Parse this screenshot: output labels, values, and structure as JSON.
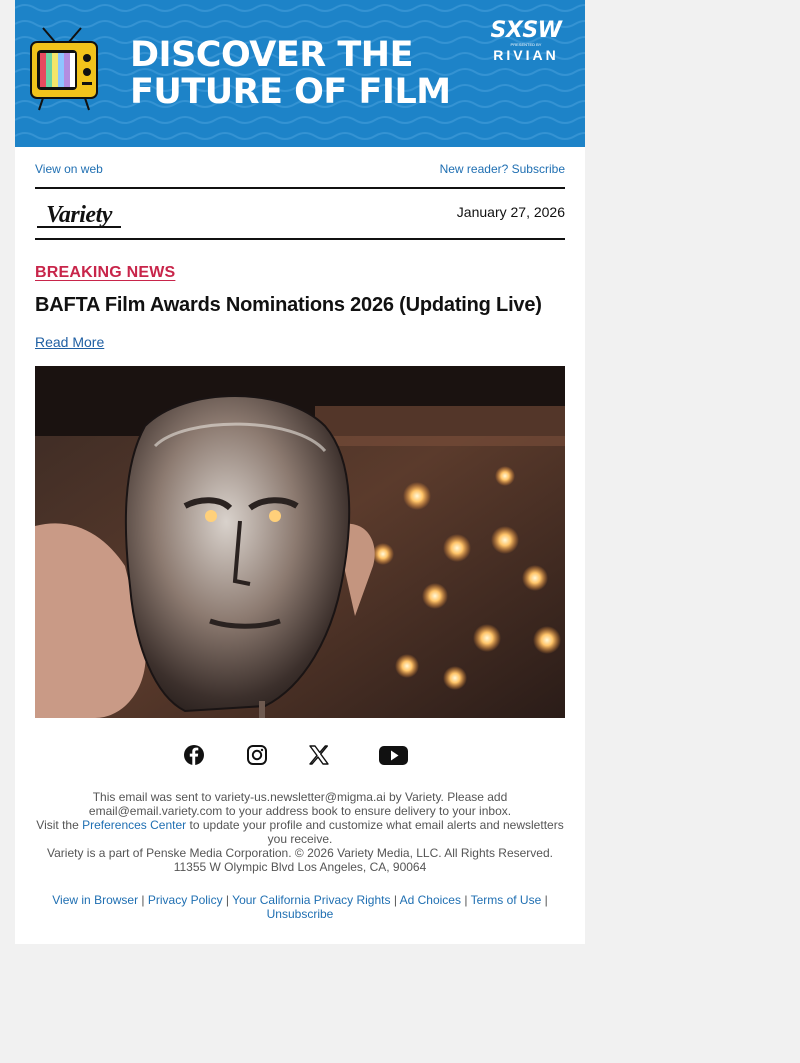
{
  "banner": {
    "line1": "DISCOVER THE",
    "line2": "FUTURE OF FILM",
    "sponsor_top": "SXSW",
    "sponsor_presented": "PRESENTED BY",
    "sponsor_bottom": "RIVIAN",
    "tv_icon": "retro-tv-icon",
    "color": "#1d83c8"
  },
  "header": {
    "view_on_web": "View on web",
    "subscribe": "New reader? Subscribe",
    "logo": "Variety",
    "date": "January 27, 2026"
  },
  "article": {
    "kicker": "BREAKING NEWS",
    "headline": "BAFTA Film Awards Nominations 2026 (Updating Live)",
    "read_more": "Read More",
    "image_alt": "BAFTA mask trophy held in hand"
  },
  "social": {
    "icons": [
      "facebook-icon",
      "instagram-icon",
      "x-icon",
      "youtube-icon"
    ]
  },
  "legal": {
    "line1": "This email was sent to variety-us.newsletter@migma.ai by Variety. Please add email@email.variety.com to your address book to ensure delivery to your inbox.",
    "visit_prefix": "Visit the",
    "preferences_link": "Preferences Center",
    "visit_suffix": "to update your profile and customize what email alerts and newsletters you receive.",
    "copyright": "Variety is a part of Penske Media Corporation. © 2026 Variety Media, LLC. All Rights Reserved.",
    "address": "11355 W Olympic Blvd Los Angeles, CA, 90064"
  },
  "footer": {
    "links": [
      "View in Browser",
      "Privacy Policy",
      "Your California Privacy Rights",
      "Ad Choices",
      "Terms of Use",
      "Unsubscribe"
    ],
    "separator": "|"
  },
  "colors": {
    "accent_red": "#c8254a",
    "link_blue": "#1f6fb2"
  }
}
